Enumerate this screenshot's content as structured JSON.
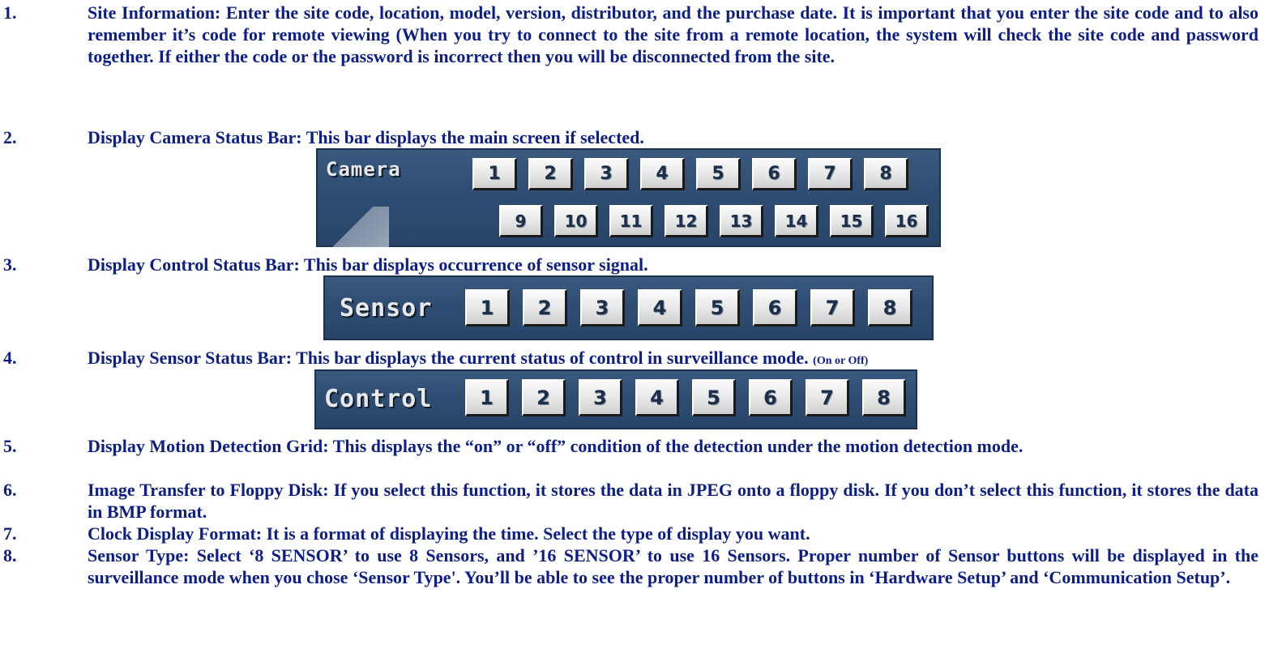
{
  "items": [
    {
      "num": "1.",
      "text": "Site Information: Enter the site code, location, model, version, distributor, and the purchase date. It is important that you enter the site code and to also remember it’s code for remote viewing (When you try to connect to the site from a remote location, the system will check the site code and password together. If either the code or the password is incorrect then you will be disconnected from the site."
    },
    {
      "num": "2.",
      "text": "Display Camera Status Bar: This bar displays the main screen if selected."
    },
    {
      "num": "3.",
      "text": "Display Control Status Bar: This bar displays occurrence of sensor signal."
    },
    {
      "num": "4.",
      "text": "Display Sensor Status Bar: This bar displays the current status of control in surveillance mode.",
      "note": "(On or Off)"
    },
    {
      "num": "5.",
      "text": "Display Motion Detection Grid: This displays the “on” or “off” condition of the detection under the motion detection mode."
    },
    {
      "num": "6.",
      "text": "Image Transfer to Floppy Disk: If you select this function, it stores the data in JPEG onto a floppy disk. If you don’t select this function, it stores the data in BMP format."
    },
    {
      "num": "7.",
      "text": "Clock Display Format: It is a format of displaying the time. Select the type of display you want."
    },
    {
      "num": "8.",
      "text": "Sensor Type: Select ‘8 SENSOR’ to use 8 Sensors, and ’16 SENSOR’ to use 16 Sensors. Proper number of Sensor buttons will be displayed in the surveillance mode when you chose ‘Sensor Type'. You’ll be able to see the proper number of buttons in ‘Hardware Setup’ and ‘Communication Setup’."
    }
  ],
  "camera_bar": {
    "label": "Camera",
    "row1": [
      "1",
      "2",
      "3",
      "4",
      "5",
      "6",
      "7",
      "8"
    ],
    "row2": [
      "9",
      "10",
      "11",
      "12",
      "13",
      "14",
      "15",
      "16"
    ]
  },
  "sensor_bar": {
    "label": "Sensor",
    "buttons": [
      "1",
      "2",
      "3",
      "4",
      "5",
      "6",
      "7",
      "8"
    ]
  },
  "control_bar": {
    "label": "Control",
    "buttons": [
      "1",
      "2",
      "3",
      "4",
      "5",
      "6",
      "7",
      "8"
    ]
  }
}
